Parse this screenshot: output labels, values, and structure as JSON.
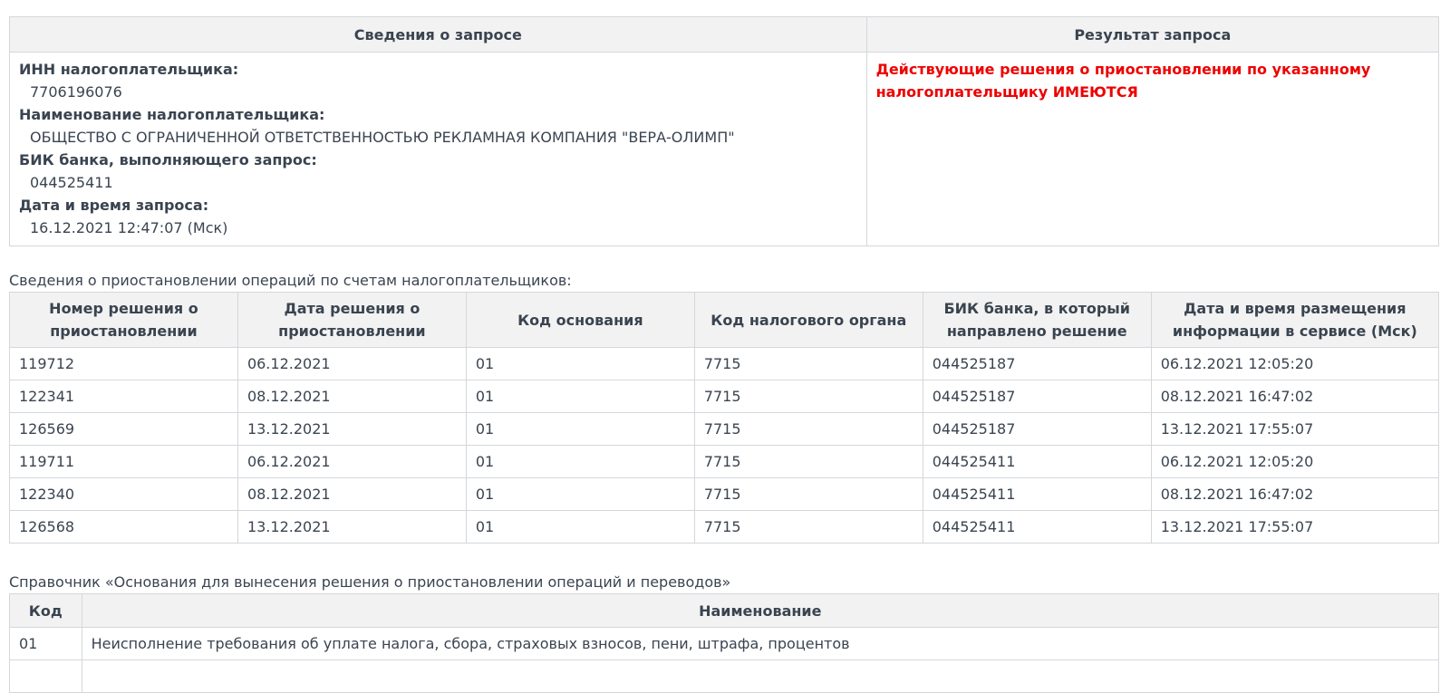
{
  "query_table": {
    "headers": [
      "Сведения о запросе",
      "Результат запроса"
    ],
    "fields": [
      {
        "label": "ИНН налогоплательщика:",
        "value": "7706196076"
      },
      {
        "label": "Наименование налогоплательщика:",
        "value": "ОБЩЕСТВО С ОГРАНИЧЕННОЙ ОТВЕТСТВЕННОСТЬЮ РЕКЛАМНАЯ КОМПАНИЯ \"ВЕРА-ОЛИМП\""
      },
      {
        "label": "БИК банка, выполняющего запрос:",
        "value": "044525411"
      },
      {
        "label": "Дата и время запроса:",
        "value": "16.12.2021 12:47:07 (Мск)"
      }
    ],
    "result": "Действующие решения о приостановлении по указанному налогоплательщику ИМЕЮТСЯ",
    "result_color": "#ee0000"
  },
  "suspensions": {
    "caption": "Сведения о приостановлении операций по счетам налогоплательщиков:",
    "headers": [
      "Номер решения о приостановлении",
      "Дата решения о приостановлении",
      "Код основания",
      "Код налогового органа",
      "БИК банка, в который направлено решение",
      "Дата и время размещения информации в сервисе (Мск)"
    ],
    "rows": [
      [
        "119712",
        "06.12.2021",
        "01",
        "7715",
        "044525187",
        "06.12.2021 12:05:20"
      ],
      [
        "122341",
        "08.12.2021",
        "01",
        "7715",
        "044525187",
        "08.12.2021 16:47:02"
      ],
      [
        "126569",
        "13.12.2021",
        "01",
        "7715",
        "044525187",
        "13.12.2021 17:55:07"
      ],
      [
        "119711",
        "06.12.2021",
        "01",
        "7715",
        "044525411",
        "06.12.2021 12:05:20"
      ],
      [
        "122340",
        "08.12.2021",
        "01",
        "7715",
        "044525411",
        "08.12.2021 16:47:02"
      ],
      [
        "126568",
        "13.12.2021",
        "01",
        "7715",
        "044525411",
        "13.12.2021 17:55:07"
      ]
    ]
  },
  "reference": {
    "caption": "Справочник «Основания для вынесения решения о приостановлении операций и переводов»",
    "headers": [
      "Код",
      "Наименование"
    ],
    "rows": [
      [
        "01",
        "Неисполнение требования об уплате налога, сбора, страховых взносов, пени, штрафа, процентов"
      ],
      [
        "",
        ""
      ]
    ]
  }
}
